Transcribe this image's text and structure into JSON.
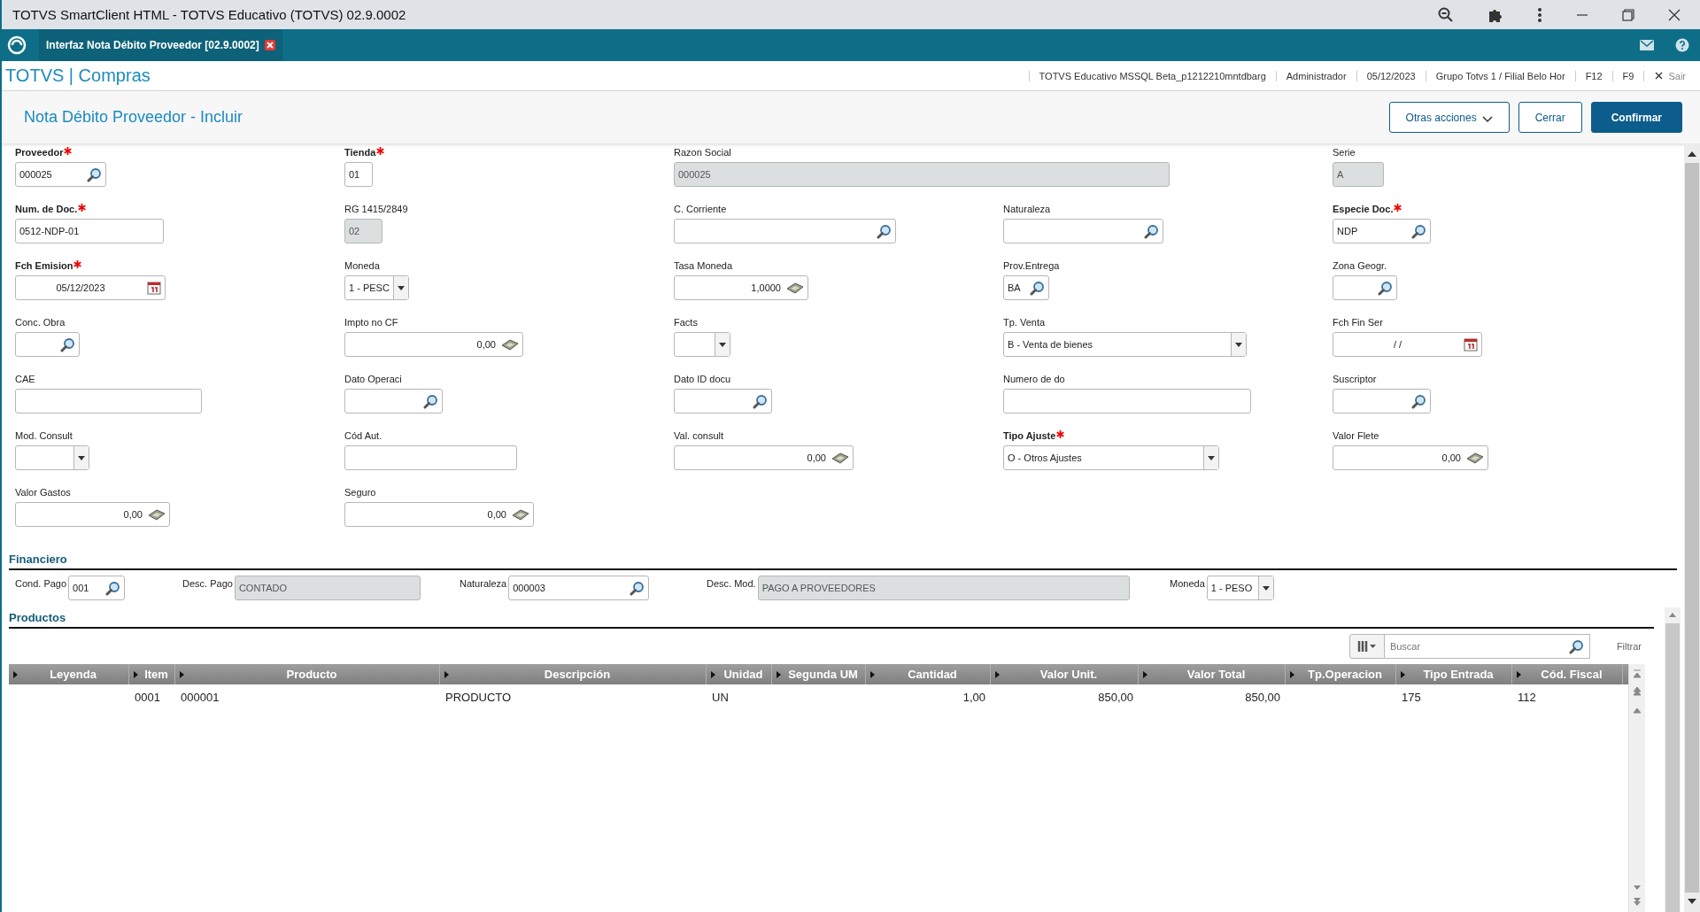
{
  "browser": {
    "title": "TOTVS SmartClient HTML - TOTVS Educativo (TOTVS) 02.9.0002"
  },
  "tab": {
    "label": "Interfaz Nota Débito Proveedor [02.9.0002]"
  },
  "header": {
    "app": "TOTVS | Compras",
    "info": [
      "TOTVS Educativo MSSQL Beta_p1212210mntdbarg",
      "Administrador",
      "05/12/2023",
      "Grupo Totvs 1 / Filial Belo Hor",
      "F12",
      "F9"
    ],
    "exit": "Sair"
  },
  "page": {
    "title": "Nota Débito Proveedor - Incluir",
    "buttons": [
      {
        "label": "Otras acciones",
        "kind": "menu"
      },
      {
        "label": "Cerrar",
        "kind": "secondary"
      },
      {
        "label": "Confirmar",
        "kind": "primary"
      }
    ]
  },
  "form": {
    "rows": [
      [
        {
          "label": "Proveedor",
          "required": true,
          "kind": "lookup",
          "value": "000025",
          "disabled": false
        },
        {
          "label": "Tienda",
          "required": true,
          "kind": "text",
          "value": "01",
          "disabled": false
        },
        {
          "label": "Razon Social",
          "required": false,
          "kind": "text",
          "value": "000025",
          "disabled": true
        },
        "",
        {
          "label": "Serie",
          "required": false,
          "kind": "text",
          "value": "A",
          "disabled": true
        }
      ],
      [
        {
          "label": "Num. de Doc.",
          "required": true,
          "kind": "text",
          "value": "0512-NDP-01",
          "disabled": false
        },
        {
          "label": "RG 1415/2849",
          "required": false,
          "kind": "text",
          "value": "02",
          "disabled": true
        },
        {
          "label": "C. Corriente",
          "required": false,
          "kind": "lookup",
          "disabled": false
        },
        {
          "label": "Naturaleza",
          "required": false,
          "kind": "lookup",
          "disabled": false
        },
        {
          "label": "Especie Doc.",
          "required": true,
          "kind": "lookup",
          "value": "NDP",
          "disabled": false
        }
      ],
      [
        {
          "label": "Fch Emision",
          "required": true,
          "kind": "date",
          "value": "05/12/2023",
          "disabled": false
        },
        {
          "label": "Moneda",
          "required": false,
          "kind": "select",
          "value": "1 - PESC",
          "disabled": false
        },
        {
          "label": "Tasa Moneda",
          "required": false,
          "kind": "money",
          "value": "1,0000",
          "disabled": false
        },
        {
          "label": "Prov.Entrega",
          "required": false,
          "kind": "lookup",
          "value": "BA",
          "disabled": false
        },
        {
          "label": "Zona Geogr.",
          "required": false,
          "kind": "lookup",
          "disabled": false
        }
      ],
      [
        {
          "label": "Conc. Obra",
          "required": false,
          "kind": "lookup",
          "disabled": false
        },
        {
          "label": "Impto no CF",
          "required": false,
          "kind": "money",
          "value": "0,00",
          "disabled": false
        },
        {
          "label": "Facts",
          "required": false,
          "kind": "select",
          "disabled": false
        },
        {
          "label": "Tp. Venta",
          "required": false,
          "kind": "select",
          "value": "B - Venta de bienes",
          "disabled": false
        },
        {
          "label": "Fch Fin Ser",
          "required": false,
          "kind": "date",
          "value": "/  /",
          "disabled": false
        }
      ],
      [
        {
          "label": "CAE",
          "required": false,
          "kind": "text",
          "disabled": false
        },
        {
          "label": "Dato Operaci",
          "required": false,
          "kind": "lookup",
          "disabled": false
        },
        {
          "label": "Dato ID docu",
          "required": false,
          "kind": "lookup",
          "disabled": false
        },
        {
          "label": "Numero de do",
          "required": false,
          "kind": "text",
          "disabled": false
        },
        {
          "label": "Suscriptor",
          "required": false,
          "kind": "lookup",
          "disabled": false
        }
      ],
      [
        {
          "label": "Mod. Consult",
          "required": false,
          "kind": "select",
          "disabled": false
        },
        {
          "label": "Cód Aut.",
          "required": false,
          "kind": "text",
          "disabled": false
        },
        {
          "label": "Val. consult",
          "required": false,
          "kind": "money",
          "value": "0,00",
          "disabled": false
        },
        {
          "label": "Tipo Ajuste",
          "required": true,
          "kind": "select",
          "value": "O - Otros Ajustes",
          "disabled": false
        },
        {
          "label": "Valor Flete",
          "required": false,
          "kind": "money",
          "value": "0,00",
          "disabled": false
        }
      ],
      [
        {
          "label": "Valor Gastos",
          "required": false,
          "kind": "money",
          "value": "0,00",
          "disabled": false
        },
        {
          "label": "Seguro",
          "required": false,
          "kind": "money",
          "value": "0,00",
          "disabled": false
        }
      ]
    ]
  },
  "financiero": {
    "title": "Financiero",
    "fields": [
      {
        "label": "Cond. Pago",
        "kind": "lookup",
        "value": "001",
        "disabled": false
      },
      {
        "label": "Desc. Pago",
        "kind": "text",
        "value": "CONTADO",
        "disabled": true
      },
      {
        "label": "Naturaleza",
        "kind": "lookup",
        "value": "000003",
        "disabled": false
      },
      {
        "label": "Desc. Mod.",
        "kind": "text",
        "value": "PAGO A PROVEEDORES",
        "disabled": true
      },
      {
        "label": "Moneda",
        "kind": "select",
        "value": "1 - PESO",
        "disabled": false
      }
    ]
  },
  "productos": {
    "title": "Productos",
    "search": {
      "placeholder": "Buscar"
    },
    "filter": "Filtrar",
    "columns": [
      "Leyenda",
      "Item",
      "Producto",
      "Descripción",
      "Unidad",
      "Segunda UM",
      "Cantidad",
      "Valor Unit.",
      "Valor Total",
      "Tp.Operacion",
      "Tipo Entrada",
      "Cód. Fiscal"
    ],
    "rows": [
      {
        "item": "0001",
        "producto": "000001",
        "descripcion": "PRODUCTO",
        "unidad": "UN",
        "cantidad": "1,00",
        "valor_unit": "850,00",
        "valor_total": "850,00",
        "tipo_entrada": "175",
        "cod_fiscal": "112"
      }
    ]
  }
}
